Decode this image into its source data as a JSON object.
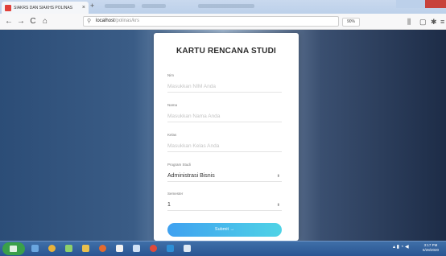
{
  "browser": {
    "tab_title": "SIAKRS DAN SIAKHS POLINAS",
    "tab_close": "×",
    "new_tab": "+",
    "url_host": "localhost",
    "url_path": "/polinas/krs",
    "zoom": "90%",
    "nav": {
      "back": "←",
      "forward": "→",
      "reload": "C",
      "home": "⌂"
    }
  },
  "form": {
    "title": "KARTU RENCANA STUDI",
    "fields": [
      {
        "label": "Nim",
        "placeholder": "Masukkan NIM Anda"
      },
      {
        "label": "Nama",
        "placeholder": "Masukkan Nama Anda"
      },
      {
        "label": "Kelas",
        "placeholder": "Masukkan Kelas Anda"
      }
    ],
    "program_label": "Program Studi",
    "program_value": "Administrasi Bisnis",
    "semester_label": "Semester",
    "semester_value": "1",
    "submit_label": "Submit →"
  },
  "taskbar": {
    "clock_time": "3:17 PM",
    "clock_date": "6/28/2020"
  },
  "colors": {
    "accent_start": "#3fa1f0",
    "accent_end": "#4fd3e6",
    "background_dark": "#1f3252"
  }
}
